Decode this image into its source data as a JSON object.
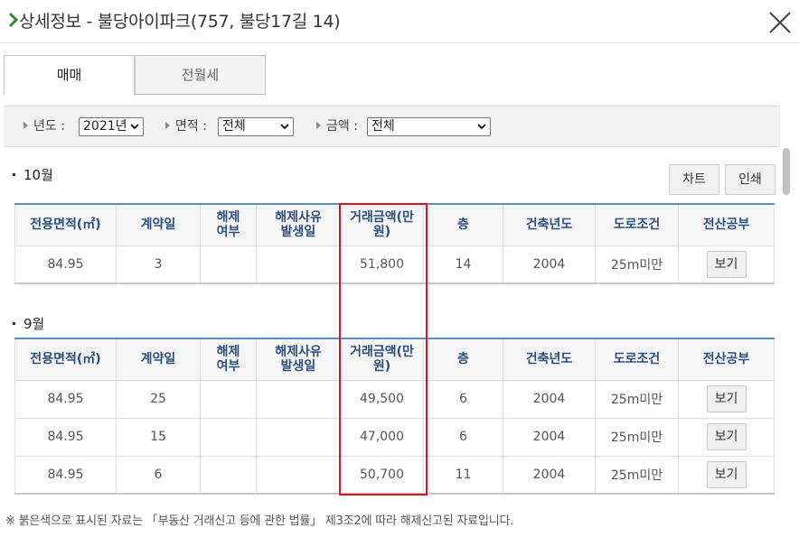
{
  "window": {
    "title": "상세정보 - 불당아이파크(757, 불당17길 14)",
    "arrow_icon": "chevron-right-icon",
    "close_icon": "close-icon",
    "arrow_color": "#2e8b2e"
  },
  "tabs": [
    {
      "label": "매매",
      "active": true
    },
    {
      "label": "전월세",
      "active": false
    }
  ],
  "filters": {
    "year_label": "년도 :",
    "year_value": "2021년",
    "area_label": "면적 :",
    "area_value": "전체",
    "amount_label": "금액 :",
    "amount_value": "전체"
  },
  "buttons": {
    "chart": "차트",
    "print": "인쇄"
  },
  "table_headers": [
    "전용면적(㎡)",
    "계약일",
    "해제\n여부",
    "해제사유\n발생일",
    "거래금액(만\n원)",
    "층",
    "건축년도",
    "도로조건",
    "전산공부"
  ],
  "months": [
    {
      "label": "10월",
      "rows": [
        {
          "area": "84.95",
          "day": "3",
          "cancel": "",
          "cancel_date": "",
          "price": "51,800",
          "floor": "14",
          "built": "2004",
          "road": "25m미만",
          "doc": "보기"
        }
      ]
    },
    {
      "label": "9월",
      "rows": [
        {
          "area": "84.95",
          "day": "25",
          "cancel": "",
          "cancel_date": "",
          "price": "49,500",
          "floor": "6",
          "built": "2004",
          "road": "25m미만",
          "doc": "보기"
        },
        {
          "area": "84.95",
          "day": "15",
          "cancel": "",
          "cancel_date": "",
          "price": "47,000",
          "floor": "6",
          "built": "2004",
          "road": "25m미만",
          "doc": "보기"
        },
        {
          "area": "84.95",
          "day": "6",
          "cancel": "",
          "cancel_date": "",
          "price": "50,700",
          "floor": "11",
          "built": "2004",
          "road": "25m미만",
          "doc": "보기"
        }
      ]
    }
  ],
  "footnote": "※ 붉은색으로 표시된 자료는 「부동산 거래신고 등에 관한 법률」 제3조2에 따라 해제신고된 자료입니다.",
  "colors": {
    "header_text": "#2c4f80",
    "header_top_border": "#5a8dc0",
    "highlight_box": "#e8121d"
  }
}
